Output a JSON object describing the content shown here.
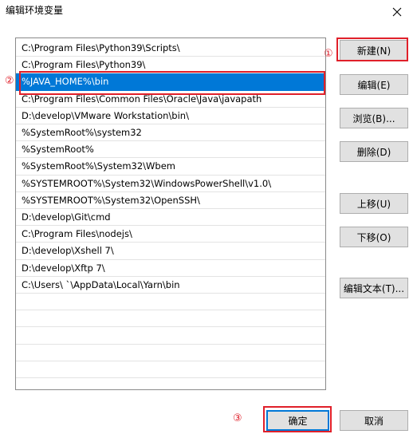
{
  "window": {
    "title": "编辑环境变量",
    "close_icon": "close-icon"
  },
  "list": {
    "selected_index": 2,
    "items": [
      "C:\\Program Files\\Python39\\Scripts\\",
      "C:\\Program Files\\Python39\\",
      "%JAVA_HOME%\\bin",
      "C:\\Program Files\\Common Files\\Oracle\\Java\\javapath",
      "D:\\develop\\VMware Workstation\\bin\\",
      "%SystemRoot%\\system32",
      "%SystemRoot%",
      "%SystemRoot%\\System32\\Wbem",
      "%SYSTEMROOT%\\System32\\WindowsPowerShell\\v1.0\\",
      "%SYSTEMROOT%\\System32\\OpenSSH\\",
      "D:\\develop\\Git\\cmd",
      "C:\\Program Files\\nodejs\\",
      "D:\\develop\\Xshell 7\\",
      "D:\\develop\\Xftp 7\\",
      "C:\\Users\\          `\\AppData\\Local\\Yarn\\bin",
      "",
      "",
      "",
      "",
      "",
      ""
    ]
  },
  "buttons": {
    "new": "新建(N)",
    "edit": "编辑(E)",
    "browse": "浏览(B)...",
    "delete": "删除(D)",
    "move_up": "上移(U)",
    "move_down": "下移(O)",
    "edit_text": "编辑文本(T)...",
    "ok": "确定",
    "cancel": "取消"
  },
  "annotations": {
    "one": "①",
    "two": "②",
    "three": "③",
    "color": "#e0202a"
  },
  "colors": {
    "selection": "#0078d7",
    "button_face": "#e1e1e1",
    "button_border": "#adadad"
  }
}
